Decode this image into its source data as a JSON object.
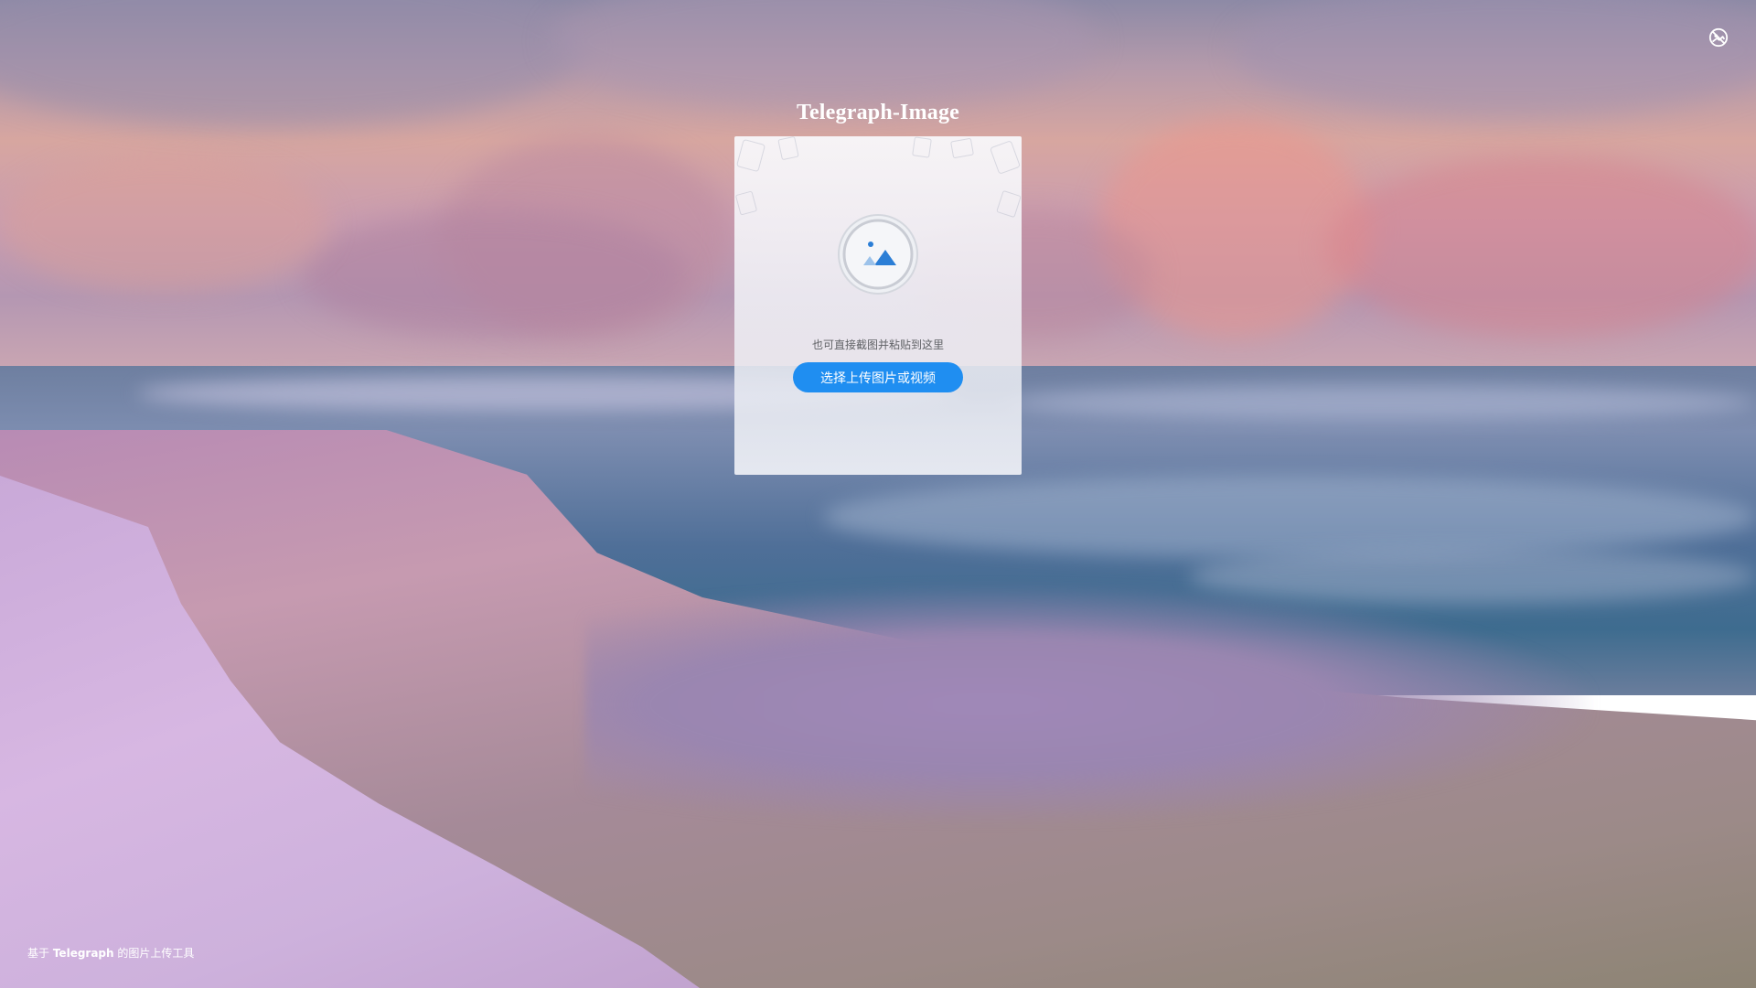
{
  "header": {
    "title": "Telegraph-Image",
    "corner_icon": "github-icon"
  },
  "upload": {
    "icon": "image-upload-icon",
    "hint": "也可直接截图并粘贴到这里",
    "button_label": "选择上传图片或视频"
  },
  "footer": {
    "prefix": "基于",
    "brand": "Telegraph",
    "suffix": "的图片上传工具"
  },
  "colors": {
    "accent": "#1f8ef1",
    "hint_text": "#606266",
    "title_text": "#ffffff"
  }
}
